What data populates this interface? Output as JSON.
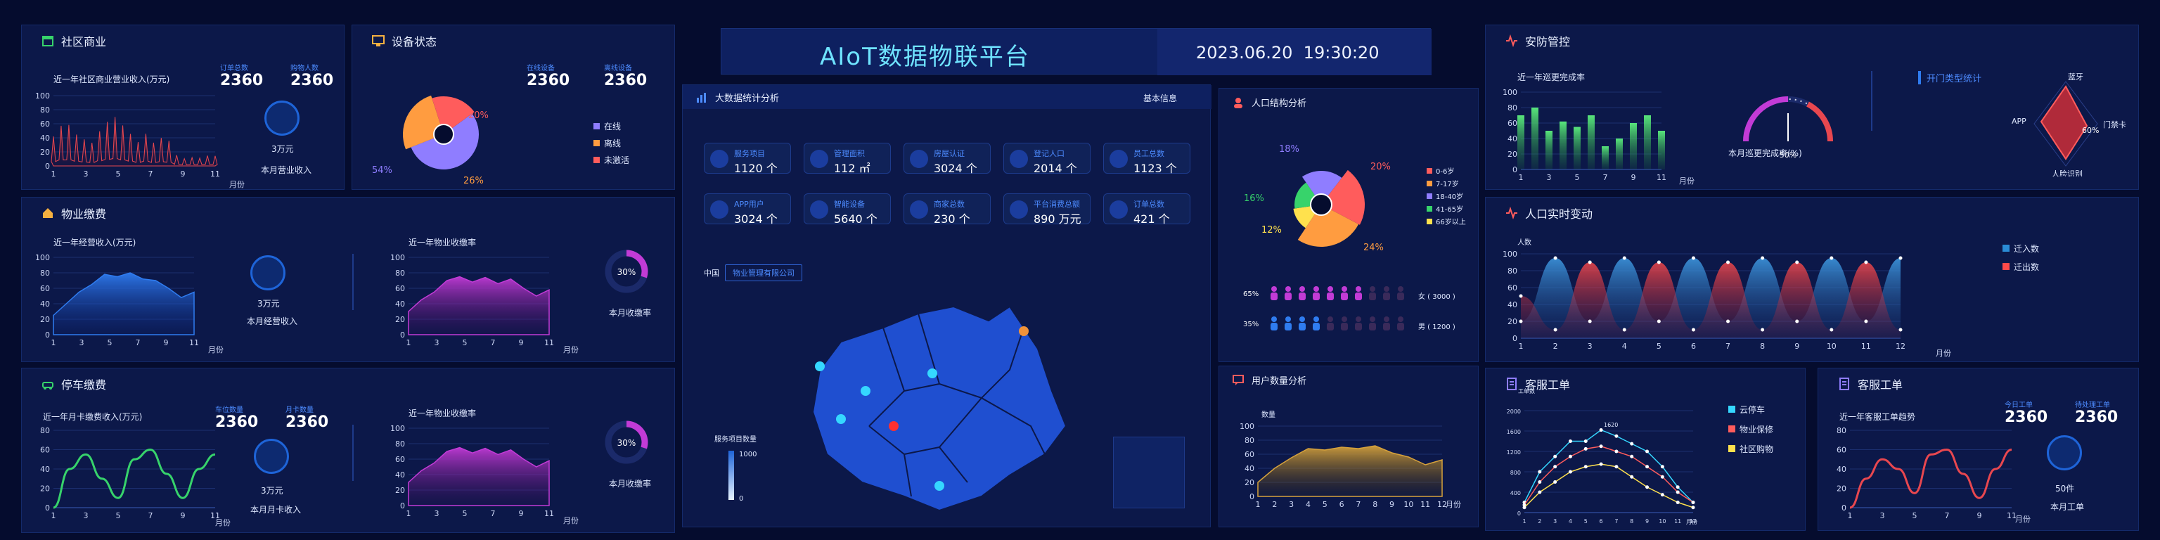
{
  "header": {
    "title": "AIoT数据物联平台",
    "datetime": "2023.06.20  19:30:20"
  },
  "community": {
    "title": "社区商业",
    "chart_title": "近一年社区商业营业收入(万元)",
    "stat1_label": "订单总数",
    "stat1_value": "2360",
    "stat2_label": "购物人数",
    "stat2_value": "2360",
    "badge_value": "3万元",
    "badge_label": "本月营业收入",
    "x_unit": "月份"
  },
  "device": {
    "title": "设备状态",
    "stat1_label": "在线设备",
    "stat1_value": "2360",
    "stat2_label": "离线设备",
    "stat2_value": "2360",
    "pct_a": "20%",
    "pct_b": "26%",
    "pct_c": "54%",
    "legend": [
      "在线",
      "离线",
      "未激活"
    ]
  },
  "property": {
    "title": "物业缴费",
    "chart1_title": "近一年经营收入(万元)",
    "badge_value": "3万元",
    "badge_label": "本月经营收入",
    "chart2_title": "近一年物业收缴率",
    "gauge_value": "30%",
    "gauge_label": "本月收缴率",
    "x_unit": "月份"
  },
  "parking": {
    "title": "停车缴费",
    "chart1_title": "近一年月卡缴费收入(万元)",
    "stat1_label": "车位数量",
    "stat1_value": "2360",
    "stat2_label": "月卡数量",
    "stat2_value": "2360",
    "badge_value": "3万元",
    "badge_label": "本月月卡收入",
    "chart2_title": "近一年物业收缴率",
    "gauge_value": "30%",
    "gauge_label": "本月收缴率",
    "x_unit": "月份"
  },
  "bigdata": {
    "title": "大数据统计分析",
    "tab": "基本信息",
    "cards": [
      {
        "label": "服务项目",
        "value": "1120 个"
      },
      {
        "label": "管理面积",
        "value": "112 ㎡"
      },
      {
        "label": "房屋认证",
        "value": "3024 个"
      },
      {
        "label": "登记人口",
        "value": "2014 个"
      },
      {
        "label": "员工总数",
        "value": "1123 个"
      },
      {
        "label": "APP用户",
        "value": "3024 个"
      },
      {
        "label": "智能设备",
        "value": "5640 个"
      },
      {
        "label": "商家总数",
        "value": "230 个"
      },
      {
        "label": "平台消费总额",
        "value": "890 万元"
      },
      {
        "label": "订单总数",
        "value": "421 个"
      }
    ],
    "breadcrumb_1": "中国",
    "breadcrumb_2": "物业管理有限公司",
    "legend_title": "服务项目数量",
    "legend_max": "1000",
    "legend_min": "0"
  },
  "population": {
    "title": "人口结构分析",
    "pcts": [
      "18%",
      "20%",
      "16%",
      "12%",
      "24%"
    ],
    "legend": [
      "0-6岁",
      "7-17岁",
      "18-40岁",
      "41-65岁",
      "66岁以上"
    ],
    "female_pct": "65%",
    "female_label": "女 ( 3000 )",
    "male_pct": "35%",
    "male_label": "男 ( 1200 )"
  },
  "users": {
    "title": "用户数量分析",
    "y_title": "数量",
    "x_unit": "月份"
  },
  "security": {
    "title": "安防管控",
    "chart_title": "近一年巡更完成率",
    "x_unit": "月份",
    "gauge_label": "本月巡更完成率(%)",
    "gauge_value": "50%",
    "radar_title": "开门类型统计",
    "radar_labels": [
      "蓝牙",
      "门禁卡",
      "人脸识别",
      "APP"
    ],
    "radar_pct": "60%"
  },
  "realtime": {
    "title": "人口实时变动",
    "y_title": "人数",
    "x_unit": "月份",
    "legend": [
      "迁入数",
      "迁出数"
    ]
  },
  "service1": {
    "title": "客服工单",
    "y_title": "工单数",
    "peak_label": "1620",
    "x_unit": "月份",
    "legend": [
      "云停车",
      "物业保修",
      "社区购物"
    ]
  },
  "service2": {
    "title": "客服工单",
    "chart_title": "近一年客服工单趋势",
    "stat1_label": "今日工单",
    "stat1_value": "2360",
    "stat2_label": "待处理工单",
    "stat2_value": "2360",
    "badge_value": "50件",
    "badge_label": "本月工单",
    "x_unit": "月份"
  },
  "colors": {
    "bg": "#050c2e",
    "panel": "#0c1849",
    "accent_cyan": "#35d7ff",
    "red": "#e8474f",
    "magenta": "#c23bd6",
    "blue": "#2f7cf0",
    "green": "#37d36b",
    "gold": "#d6a23c"
  },
  "chart_data": [
    {
      "type": "area",
      "title": "近一年社区商业营业收入(万元)",
      "x": [
        1,
        3,
        5,
        7,
        9,
        11
      ],
      "ylim": [
        0,
        100
      ],
      "y_ticks": [
        0,
        20,
        40,
        60,
        80,
        100
      ],
      "series": [
        {
          "values": [
            60,
            80,
            70,
            85,
            40,
            25,
            15
          ]
        }
      ]
    },
    {
      "type": "pie",
      "title": "设备状态",
      "values": [
        54,
        26,
        20
      ],
      "labels": [
        "在线",
        "离线",
        "未激活"
      ]
    },
    {
      "type": "area",
      "title": "近一年经营收入(万元)",
      "x": [
        1,
        3,
        5,
        7,
        9,
        11
      ],
      "ylim": [
        0,
        100
      ],
      "y_ticks": [
        0,
        20,
        40,
        60,
        80,
        100
      ],
      "series": [
        {
          "values": [
            25,
            40,
            55,
            65,
            78,
            75,
            80,
            72,
            70,
            60,
            48,
            55
          ]
        }
      ]
    },
    {
      "type": "area",
      "title": "近一年物业收缴率",
      "x": [
        1,
        3,
        5,
        7,
        9,
        11
      ],
      "ylim": [
        0,
        100
      ],
      "y_ticks": [
        0,
        20,
        40,
        60,
        80,
        100
      ],
      "series": [
        {
          "values": [
            30,
            45,
            55,
            70,
            75,
            68,
            74,
            66,
            72,
            60,
            50,
            58
          ]
        }
      ]
    },
    {
      "type": "line",
      "title": "近一年月卡缴费收入(万元)",
      "x": [
        1,
        3,
        5,
        7,
        9,
        11
      ],
      "ylim": [
        0,
        80
      ],
      "y_ticks": [
        0,
        20,
        40,
        60,
        80
      ],
      "series": [
        {
          "values": [
            0,
            40,
            55,
            30,
            10,
            50,
            60,
            35,
            10,
            40,
            55
          ]
        }
      ]
    },
    {
      "type": "area",
      "title": "近一年物业收缴率",
      "x": [
        1,
        3,
        5,
        7,
        9,
        11
      ],
      "ylim": [
        0,
        100
      ],
      "y_ticks": [
        0,
        20,
        40,
        60,
        80,
        100
      ],
      "series": [
        {
          "values": [
            30,
            45,
            55,
            70,
            75,
            68,
            74,
            66,
            72,
            60,
            50,
            58
          ]
        }
      ]
    },
    {
      "type": "area",
      "title": "用户数量分析",
      "x": [
        1,
        2,
        3,
        4,
        5,
        6,
        7,
        8,
        9,
        10,
        11,
        12
      ],
      "ylim": [
        0,
        100
      ],
      "y_ticks": [
        0,
        20,
        40,
        60,
        80,
        100
      ],
      "series": [
        {
          "values": [
            20,
            40,
            55,
            68,
            66,
            70,
            68,
            72,
            62,
            56,
            45,
            52
          ]
        }
      ]
    },
    {
      "type": "bar",
      "title": "近一年巡更完成率",
      "x": [
        1,
        3,
        5,
        7,
        9,
        11
      ],
      "ylim": [
        0,
        100
      ],
      "y_ticks": [
        0,
        20,
        40,
        60,
        80,
        100
      ],
      "values": [
        70,
        80,
        50,
        62,
        55,
        70,
        30,
        40,
        60,
        70,
        50
      ]
    },
    {
      "type": "area",
      "title": "人口实时变动",
      "x": [
        1,
        2,
        3,
        4,
        5,
        6,
        7,
        8,
        9,
        10,
        11,
        12
      ],
      "ylim": [
        0,
        100
      ],
      "y_ticks": [
        0,
        20,
        40,
        60,
        80,
        100
      ],
      "series": [
        {
          "name": "迁入数",
          "values": [
            20,
            95,
            20,
            95,
            20,
            95,
            20,
            95,
            20,
            95,
            20,
            95
          ]
        },
        {
          "name": "迁出数",
          "values": [
            50,
            10,
            90,
            10,
            90,
            10,
            90,
            10,
            90,
            10,
            90,
            10
          ]
        }
      ]
    },
    {
      "type": "line",
      "title": "客服工单",
      "x": [
        1,
        2,
        3,
        4,
        5,
        6,
        7,
        8,
        9,
        10,
        11,
        12
      ],
      "ylim": [
        0,
        2000
      ],
      "y_ticks": [
        0,
        400,
        800,
        1200,
        1600,
        2000
      ],
      "series": [
        {
          "name": "云停车",
          "values": [
            200,
            800,
            1100,
            1400,
            1400,
            1620,
            1500,
            1350,
            1200,
            900,
            500,
            200
          ]
        },
        {
          "name": "物业保修",
          "values": [
            150,
            600,
            900,
            1100,
            1250,
            1300,
            1200,
            1100,
            900,
            700,
            400,
            200
          ]
        },
        {
          "name": "社区购物",
          "values": [
            100,
            400,
            600,
            800,
            900,
            950,
            900,
            700,
            500,
            350,
            200,
            100
          ]
        }
      ]
    },
    {
      "type": "line",
      "title": "近一年客服工单趋势",
      "x": [
        1,
        3,
        5,
        7,
        9,
        11
      ],
      "ylim": [
        0,
        80
      ],
      "y_ticks": [
        0,
        20,
        40,
        60,
        80
      ],
      "series": [
        {
          "values": [
            0,
            30,
            50,
            40,
            15,
            55,
            60,
            35,
            10,
            40,
            60
          ]
        }
      ]
    }
  ]
}
